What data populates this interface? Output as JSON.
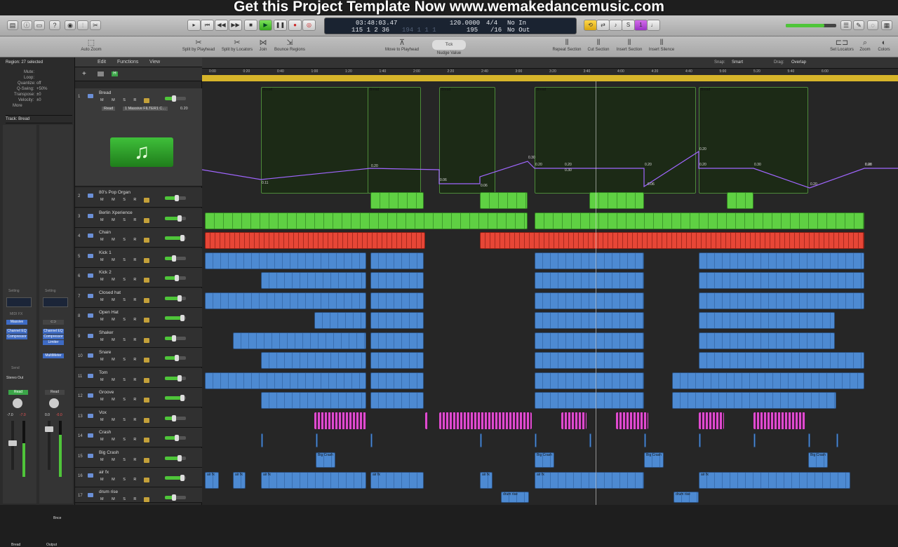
{
  "promo": "Get this Project Template Now www.wemakedancemusic.com",
  "lcd": {
    "time": "03:48:03.47",
    "bars": "115  1  2   36",
    "bars_dim": "194  1  1   1",
    "tempo": "120.0000",
    "tempo2": "195",
    "sig": "4/4",
    "div": "/16",
    "in": "No In",
    "out": "No Out"
  },
  "toolbar": {
    "auto_zoom": "Auto Zoom",
    "split_playhead": "Split by Playhead",
    "split_locators": "Split by Locators",
    "join": "Join",
    "bounce": "Bounce Regions",
    "move_playhead": "Move to Playhead",
    "nudge": "Nudge Value",
    "tick": "Tick",
    "repeat_section": "Repeat Section",
    "cut_section": "Cut Section",
    "insert_section": "Insert Section",
    "insert_silence": "Insert Silence",
    "set_locators": "Set Locators",
    "zoom": "Zoom",
    "colors": "Colors"
  },
  "inspector": {
    "region": "Region: 27 selected",
    "mute": "Mute:",
    "loop": "Loop:",
    "quantize": "Quantize:",
    "quantize_val": "off",
    "qswing": "Q-Swing:",
    "qswing_val": "+50%",
    "transpose": "Transpose:",
    "transpose_val": "±0",
    "velocity": "Velocity:",
    "velocity_val": "±0",
    "more": "More",
    "track": "Track:  Bread",
    "setting": "Setting",
    "midi_fx": "MIDI FX",
    "massive": "Massive",
    "ch_eq": "Channel EQ",
    "compressor": "Compressor",
    "limiter": "Limiter",
    "multimeter": "MultiMeter",
    "send": "Send",
    "stereo_out": "Stereo Out",
    "read": "Read",
    "vol1": "-7.0",
    "vol1b": "-7.0",
    "vol2": "0.0",
    "vol2b": "-0.0",
    "bnce": "Bnce",
    "strip1": "Bread",
    "strip2": "Output"
  },
  "header_menu": {
    "edit": "Edit",
    "functions": "Functions",
    "view": "View",
    "snap": "Snap:",
    "snap_val": "Smart",
    "drag": "Drag:",
    "drag_val": "Overlap"
  },
  "tracks": [
    {
      "num": "1",
      "name": "Bread",
      "mode": "Read",
      "plugin": "1 Massive FILTER1 C...",
      "val": "0.20"
    },
    {
      "num": "2",
      "name": "80's Pop Organ"
    },
    {
      "num": "3",
      "name": "Berlin Xperience"
    },
    {
      "num": "4",
      "name": "Chain"
    },
    {
      "num": "5",
      "name": "Kick 1"
    },
    {
      "num": "6",
      "name": "Kick 2"
    },
    {
      "num": "7",
      "name": "Closed hat"
    },
    {
      "num": "8",
      "name": "Open Hat"
    },
    {
      "num": "9",
      "name": "Shaker"
    },
    {
      "num": "10",
      "name": "Snare"
    },
    {
      "num": "11",
      "name": "Tom"
    },
    {
      "num": "12",
      "name": "Groove"
    },
    {
      "num": "13",
      "name": "Vox"
    },
    {
      "num": "14",
      "name": "Crash"
    },
    {
      "num": "15",
      "name": "Big Crash"
    },
    {
      "num": "16",
      "name": "air fx"
    },
    {
      "num": "17",
      "name": "drum rise"
    }
  ],
  "track_buttons": "M  M  S  R  I",
  "ruler_times": [
    "0:00",
    "0:20",
    "0:40",
    "1:00",
    "1:20",
    "1:40",
    "2:00",
    "2:20",
    "2:40",
    "3:00",
    "3:20",
    "3:40",
    "4:00",
    "4:20",
    "4:40",
    "5:00",
    "5:20",
    "5:40",
    "6:00"
  ],
  "region_labels": {
    "bread": "Bread",
    "big_crash": "Big Crash",
    "drum_rise": "drum rise",
    "air_fx": "air fx"
  },
  "automation_values": [
    "0.11",
    "0.20",
    "0.06",
    "0.06",
    "0.30",
    "0.20",
    "0.20",
    "0.30",
    "0.20",
    "0.06",
    "0.20",
    "0.20",
    "0.30",
    "0.20",
    "0.06",
    "0.20"
  ]
}
